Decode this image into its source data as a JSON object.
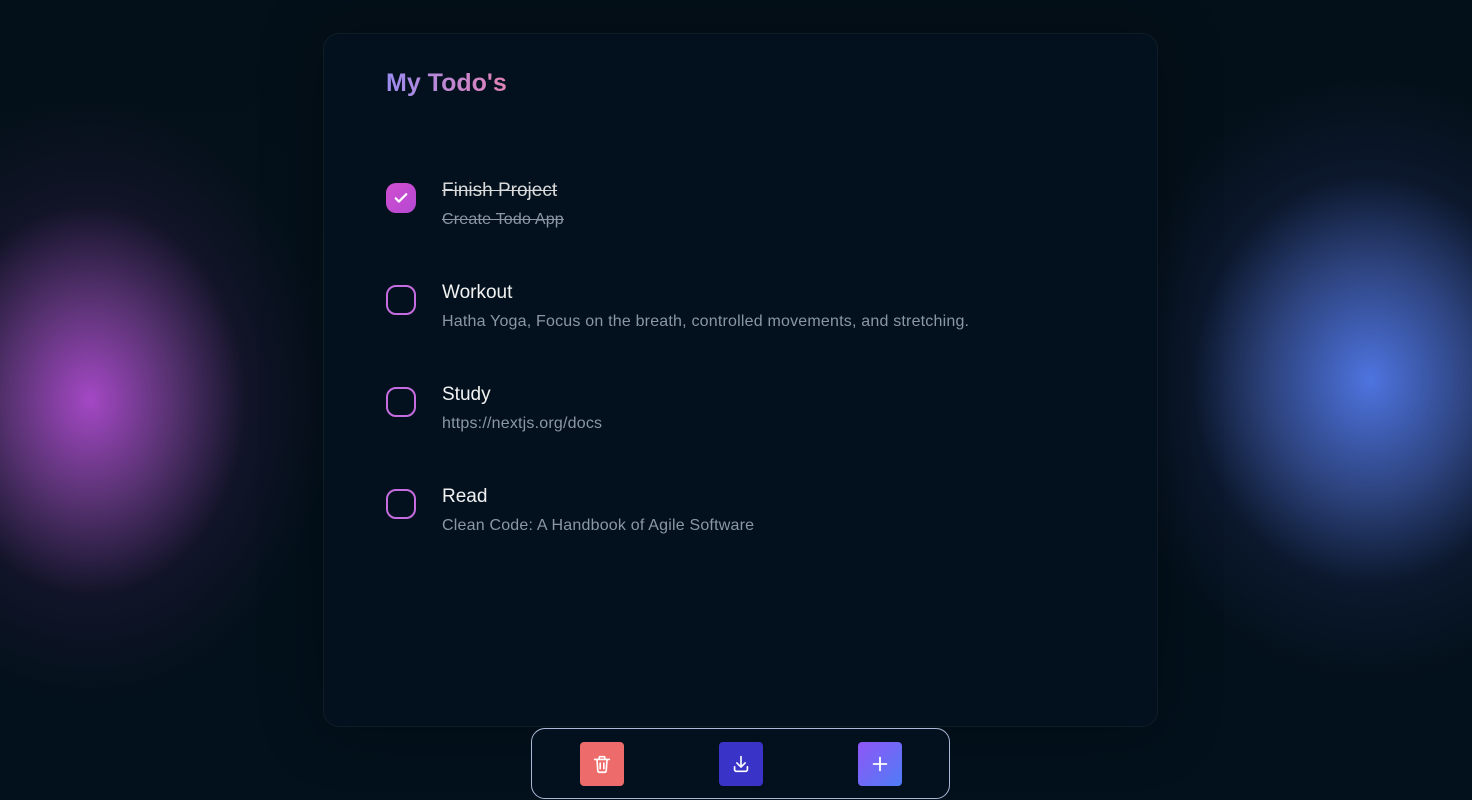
{
  "app": {
    "title": "My Todo's"
  },
  "todos": [
    {
      "title": "Finish Project",
      "description": "Create Todo App",
      "completed": true
    },
    {
      "title": "Workout",
      "description": "Hatha Yoga, Focus on the breath, controlled movements, and stretching.",
      "completed": false
    },
    {
      "title": "Study",
      "description": "https://nextjs.org/docs",
      "completed": false
    },
    {
      "title": "Read",
      "description": "Clean Code: A Handbook of Agile Software",
      "completed": false
    }
  ],
  "toolbar": {
    "delete_icon": "trash-icon",
    "download_icon": "download-icon",
    "add_icon": "plus-icon"
  },
  "colors": {
    "accent": "#c56de0",
    "delete": "#ee6b6b",
    "download": "#3a33c7",
    "add_start": "#8f56f5",
    "add_end": "#4f7cf7"
  }
}
